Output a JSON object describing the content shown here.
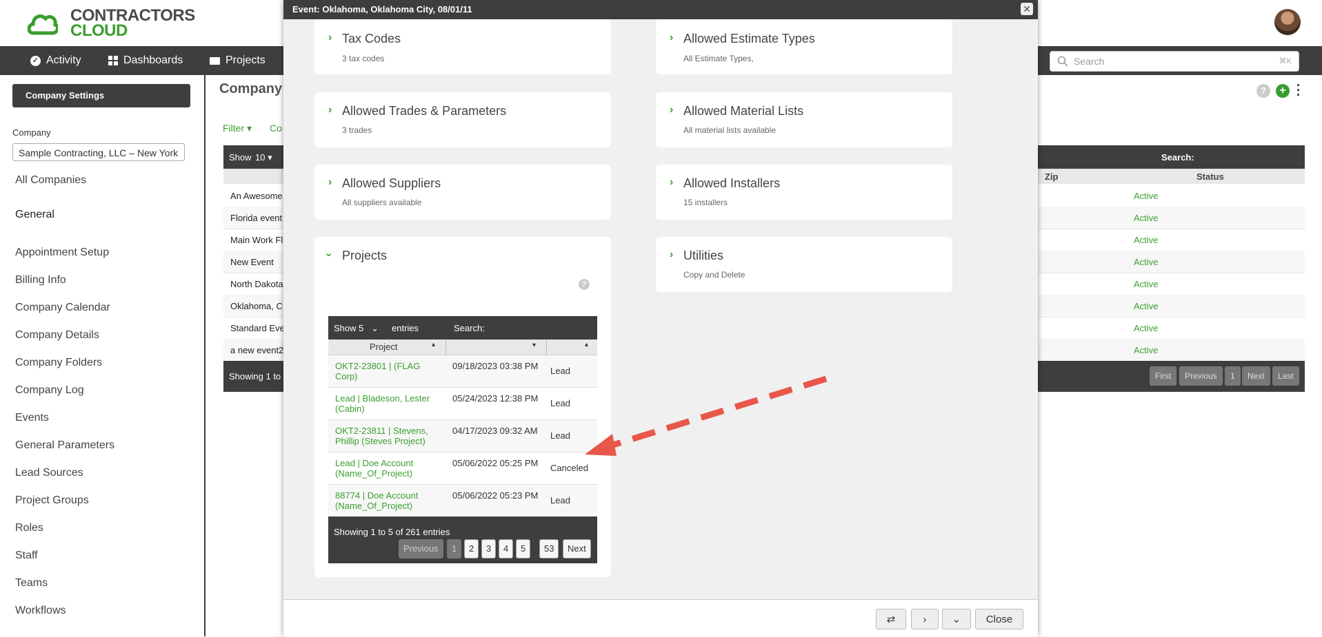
{
  "logo": {
    "line1": "CONTRACTORS",
    "line2": "CLOUD"
  },
  "nav": {
    "activity": "Activity",
    "dashboards": "Dashboards",
    "projects": "Projects"
  },
  "search": {
    "placeholder": "Search",
    "shortcut": "⌘K"
  },
  "sidebar": {
    "settings_button": "Company Settings",
    "company_label": "Company",
    "company_value": "Sample Contracting, LLC – New York",
    "all_companies": "All Companies",
    "section": "General",
    "items": [
      "Appointment Setup",
      "Billing Info",
      "Company Calendar",
      "Company Details",
      "Company Folders",
      "Company Log",
      "Events",
      "General Parameters",
      "Lead Sources",
      "Project Groups",
      "Roles",
      "Staff",
      "Teams",
      "Workflows"
    ]
  },
  "main": {
    "title": "Company",
    "filter": "Filter",
    "filter2": "Co",
    "show": "Show",
    "show_value": "10",
    "search_label": "Search:",
    "col_zip": "Zip",
    "col_status": "Status",
    "rows": [
      {
        "name": "An Awesome",
        "status": "Active"
      },
      {
        "name": "Florida event",
        "status": "Active"
      },
      {
        "name": "Main Work Fl",
        "status": "Active"
      },
      {
        "name": "New Event",
        "status": "Active"
      },
      {
        "name": "North Dakota",
        "status": "Active"
      },
      {
        "name": "Oklahoma, C",
        "status": "Active"
      },
      {
        "name": "Standard Eve",
        "status": "Active"
      },
      {
        "name": "a new event2",
        "status": "Active"
      }
    ],
    "footer_info": "Showing 1 to",
    "pager": [
      "First",
      "Previous",
      "1",
      "Next",
      "Last"
    ]
  },
  "modal": {
    "title": "Event: Oklahoma, Oklahoma City, 08/01/11",
    "close_x": "✕",
    "cards": {
      "tax": {
        "title": "Tax Codes",
        "sub": "3 tax codes"
      },
      "estimate": {
        "title": "Allowed Estimate Types",
        "sub": "All Estimate Types,"
      },
      "trades": {
        "title": "Allowed Trades & Parameters",
        "sub": "3 trades"
      },
      "materials": {
        "title": "Allowed Material Lists",
        "sub": "All material lists available"
      },
      "suppliers": {
        "title": "Allowed Suppliers",
        "sub": "All suppliers available"
      },
      "installers": {
        "title": "Allowed Installers",
        "sub": "15 installers"
      },
      "projects": {
        "title": "Projects"
      },
      "utilities": {
        "title": "Utilities",
        "sub": "Copy and Delete"
      }
    },
    "projects_table": {
      "show": "Show",
      "show_value": "5",
      "entries": "entries",
      "search_label": "Search:",
      "col_project": "Project",
      "rows": [
        {
          "project": "OKT2-23801 | (FLAG Corp)",
          "date": "09/18/2023 03:38 PM",
          "status": "Lead"
        },
        {
          "project": "Lead | Bladeson, Lester (Cabin)",
          "date": "05/24/2023 12:38 PM",
          "status": "Lead"
        },
        {
          "project": "OKT2-23811 | Stevens, Phillip (Steves Project)",
          "date": "04/17/2023 09:32 AM",
          "status": "Lead"
        },
        {
          "project": "Lead | Doe Account (Name_Of_Project)",
          "date": "05/06/2022 05:25 PM",
          "status": "Canceled"
        },
        {
          "project": "88774 | Doe Account (Name_Of_Project)",
          "date": "05/06/2022 05:23 PM",
          "status": "Lead"
        }
      ],
      "info": "Showing 1 to 5 of 261 entries",
      "pager": {
        "prev": "Previous",
        "p1": "1",
        "p2": "2",
        "p3": "3",
        "p4": "4",
        "p5": "5",
        "last": "53",
        "next": "Next"
      }
    },
    "footer": {
      "close": "Close"
    }
  },
  "colors": {
    "accent": "#3a9e2e",
    "dark": "#3e3e3e",
    "annotation_arrow": "#e8574a"
  }
}
